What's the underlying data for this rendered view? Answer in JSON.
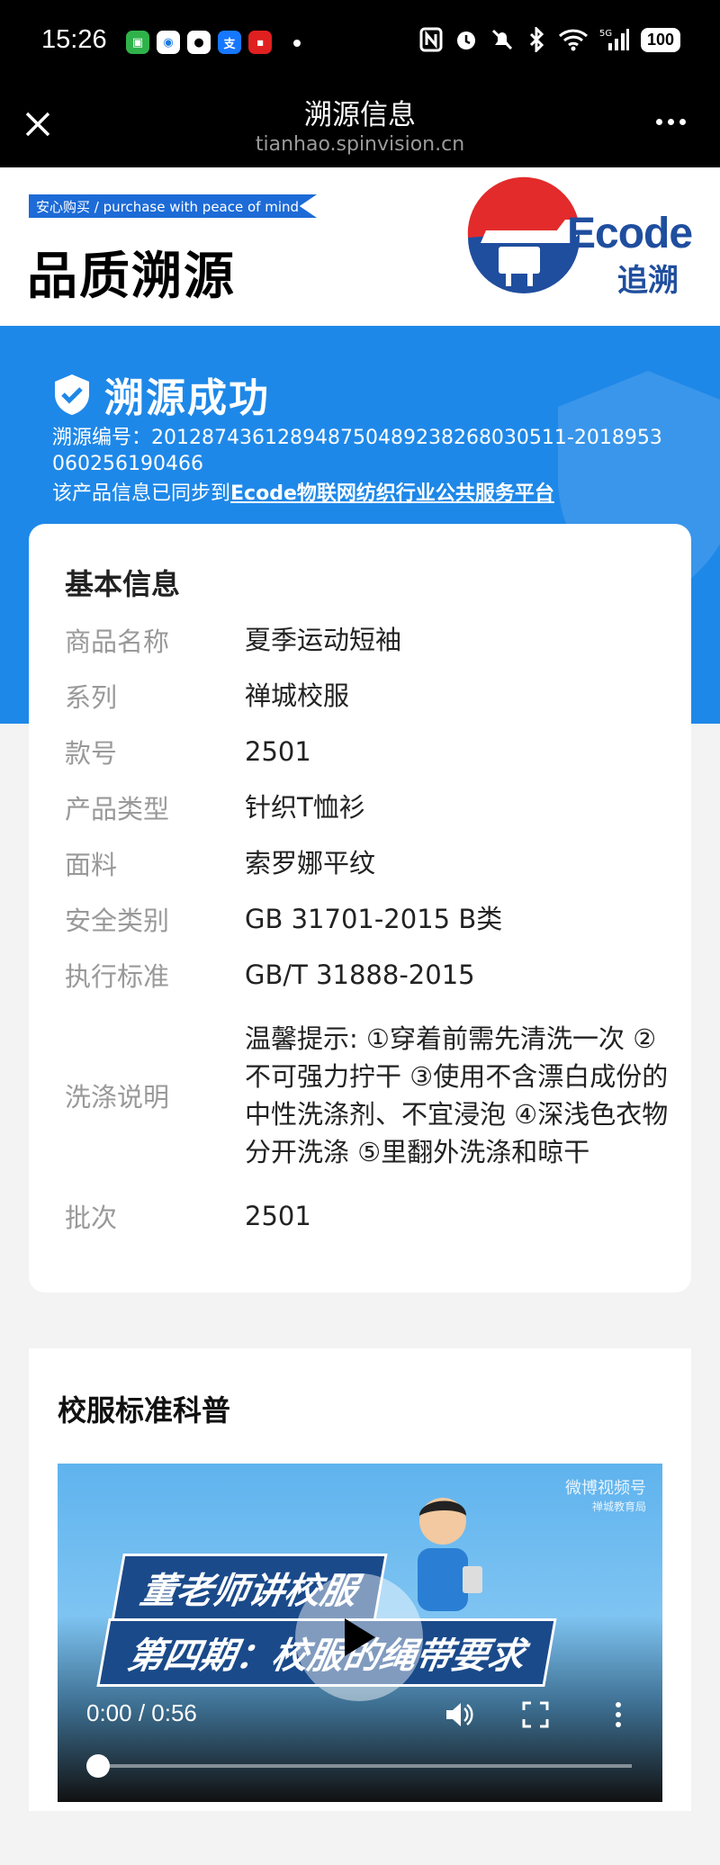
{
  "status_bar": {
    "time": "15:26",
    "battery": "100"
  },
  "nav": {
    "title": "溯源信息",
    "url": "tianhao.spinvision.cn"
  },
  "brand": {
    "ribbon": "安心购买 / purchase with peace of mind",
    "title": "品质溯源",
    "logo_word": "Ecode",
    "logo_sub": "追溯"
  },
  "banner": {
    "status": "溯源成功",
    "trace_label": "溯源编号：",
    "trace_no": "2012874361289487504892382680305​11-2018953060256190466",
    "sync_prefix": "该产品信息已同步到",
    "sync_link": "Ecode物联网纺织行业公共服务平台"
  },
  "basic_info": {
    "title": "基本信息",
    "rows": [
      {
        "label": "商品名称",
        "value": "夏季运动短袖"
      },
      {
        "label": "系列",
        "value": "禅城校服"
      },
      {
        "label": "款号",
        "value": "2501"
      },
      {
        "label": "产品类型",
        "value": "针织T恤衫"
      },
      {
        "label": "面料",
        "value": "索罗娜平纹"
      },
      {
        "label": "安全类别",
        "value": "GB 31701-2015 B类"
      },
      {
        "label": "执行标准",
        "value": "GB/T 31888-2015"
      },
      {
        "label": "洗涤说明",
        "value": "温馨提示: ①穿着前需先清洗一次 ②不可强力拧干 ③使用不含漂白成份的中性洗涤剂、不宜浸泡 ④深浅色衣物分开洗涤 ⑤里翻外洗涤和晾干"
      },
      {
        "label": "批次",
        "value": "2501"
      }
    ]
  },
  "science": {
    "title": "校服标准科普",
    "video": {
      "watermark_line1": "微博视频号",
      "watermark_line2": "禅城教育局",
      "headline1": "董老师讲校服",
      "headline2": "第四期：校服的绳带要求",
      "time": "0:00 / 0:56",
      "progress": 0
    }
  }
}
